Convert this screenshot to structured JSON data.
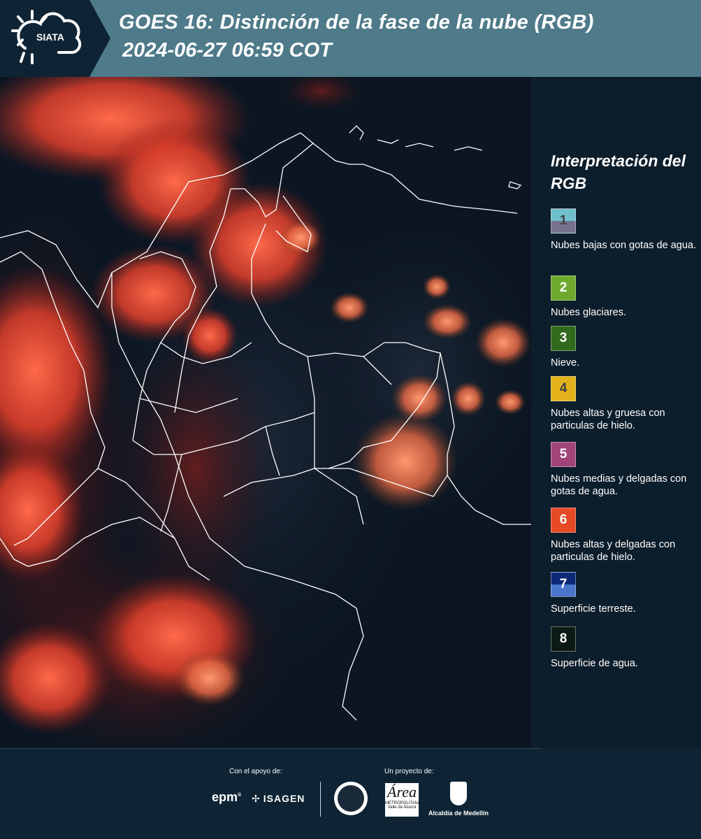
{
  "header": {
    "logo_text": "SIATA",
    "title": "GOES 16: Distinción de la fase de la nube (RGB)",
    "datetime": "2024-06-27 06:59 COT"
  },
  "legend": {
    "title": "Interpretación del RGB",
    "items": [
      {
        "number": "1",
        "label": "Nubes bajas con gotas de agua.",
        "color_top": "#6fc0cc",
        "color_bottom": "#76728d",
        "text_color": "#444444"
      },
      {
        "number": "2",
        "label": "Nubes glaciares.",
        "color_top": "#6ea92d",
        "color_bottom": "#6ea92d",
        "text_color": "#ffffff"
      },
      {
        "number": "3",
        "label": "Nieve.",
        "color_top": "#2f6a1d",
        "color_bottom": "#2f6a1d",
        "text_color": "#ffffff"
      },
      {
        "number": "4",
        "label": "Nubes altas y gruesa con particulas de hielo.",
        "color_top": "#e3b21b",
        "color_bottom": "#e3b21b",
        "text_color": "#444444"
      },
      {
        "number": "5",
        "label": "Nubes medias y delgadas con gotas de agua.",
        "color_top": "#a1447a",
        "color_bottom": "#a1447a",
        "text_color": "#ffffff"
      },
      {
        "number": "6",
        "label": "Nubes altas y delgadas con particulas de hielo.",
        "color_top": "#e54a25",
        "color_bottom": "#e54a25",
        "text_color": "#ffffff"
      },
      {
        "number": "7",
        "label": "Superficie terreste.",
        "color_top": "#0c2a78",
        "color_bottom": "#4a77cc",
        "text_color": "#ffffff"
      },
      {
        "number": "8",
        "label": "Superficie de agua.",
        "color_top": "#0b1a14",
        "color_bottom": "#0b1a14",
        "text_color": "#ffffff"
      }
    ]
  },
  "footer": {
    "support_label": "Con el apoyo de:",
    "project_label": "Un proyecto de:",
    "epm": "epm",
    "isagen": "ISAGEN",
    "amva_text": "METROPOLITANA Valle de Aburrá",
    "amva_letter": "Área",
    "medellin": "Alcaldía de Medellín"
  }
}
